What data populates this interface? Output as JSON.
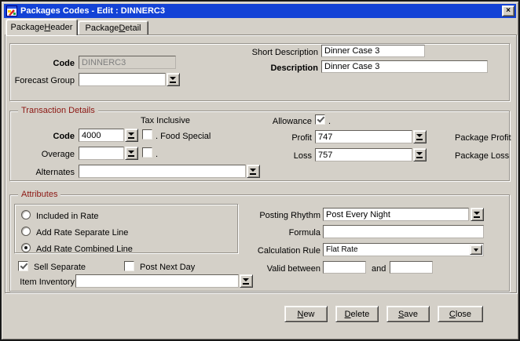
{
  "window": {
    "title": "Packages Codes - Edit : DINNERC3"
  },
  "icons": {
    "close": "×"
  },
  "colors": {
    "titlebar_blue": "#1342d6",
    "window_face": "#d4d0c8",
    "section_title_red": "#8c1713",
    "field_white": "#ffffff"
  },
  "tabs": [
    {
      "text": "Package Header",
      "u": 8
    },
    {
      "text": "Package Detail",
      "u": 8
    }
  ],
  "header_section": {
    "code_label": "Code",
    "code_value": "DINNERC3",
    "forecast_group_label": "Forecast Group",
    "forecast_group_value": "",
    "short_description_label": "Short Description",
    "short_description_value": "Dinner Case 3",
    "description_label": "Description",
    "description_value": "Dinner Case 3"
  },
  "transaction_details": {
    "title": "Transaction Details",
    "tax_inclusive_label": "Tax Inclusive",
    "code_label": "Code",
    "code_value": "4000",
    "food_special": {
      "label": ". Food Special",
      "checked": false
    },
    "overage_label": "Overage",
    "overage_value": "",
    "overage_checkbox": {
      "label": ".",
      "checked": false
    },
    "alternates_label": "Alternates",
    "alternates_value": "",
    "allowance": {
      "label": "Allowance",
      "suffix": ".",
      "checked": true
    },
    "profit_label": "Profit",
    "profit_value": "747",
    "profit_caption": "Package Profit",
    "loss_label": "Loss",
    "loss_value": "757",
    "loss_caption": "Package Loss"
  },
  "attributes_section": {
    "title": "Attributes",
    "radio_options": [
      {
        "label": "Included in Rate",
        "selected": false
      },
      {
        "label": "Add Rate Separate Line",
        "selected": false
      },
      {
        "label": "Add Rate Combined Line",
        "selected": true
      }
    ],
    "sell_separate": {
      "label": "Sell Separate",
      "checked": true
    },
    "post_next_day": {
      "label": "Post Next Day",
      "checked": false
    },
    "item_inventory_label": "Item Inventory",
    "item_inventory_value": "",
    "posting_rhythm_label": "Posting Rhythm",
    "posting_rhythm_value": "Post Every Night",
    "formula_label": "Formula",
    "formula_value": "",
    "calculation_rule_label": "Calculation Rule",
    "calculation_rule_value": "Flat Rate",
    "valid_between_label": "Valid between",
    "and_label": "and",
    "valid_from_value": "",
    "valid_to_value": ""
  },
  "buttons": [
    {
      "text": "New",
      "u": 0
    },
    {
      "text": "Delete",
      "u": 0
    },
    {
      "text": "Save",
      "u": 0
    },
    {
      "text": "Close",
      "u": 0
    }
  ]
}
